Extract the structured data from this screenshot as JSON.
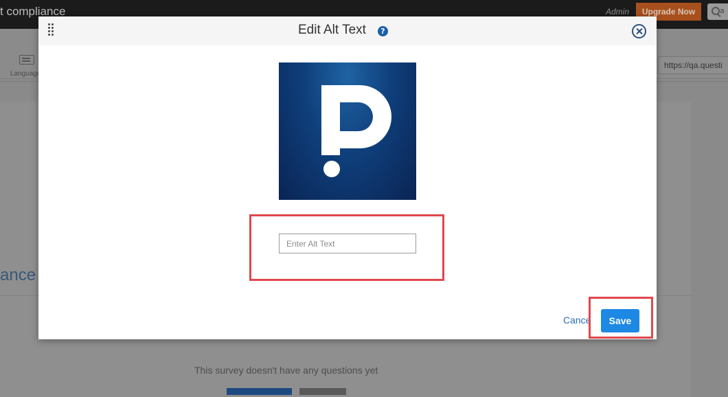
{
  "background": {
    "app_title": "t compliance",
    "admin_label": "Admin",
    "upgrade_label": "Upgrade Now",
    "search_partial": "a",
    "language_label": "Language",
    "url_text": "https://qa.questi",
    "page_heading_partial": "ance",
    "empty_message": "This survey doesn't have any questions yet"
  },
  "modal": {
    "title": "Edit Alt Text",
    "help_icon": "?",
    "close_icon": "close-circle-icon",
    "alt_input": {
      "placeholder": "Enter Alt Text",
      "value": ""
    },
    "cancel_label": "Cance",
    "save_label": "Save"
  },
  "colors": {
    "primary_button": "#1e88e5",
    "highlight": "#e0474c",
    "image_bg": "#0f3f7b",
    "upgrade_button": "#a8501d"
  }
}
